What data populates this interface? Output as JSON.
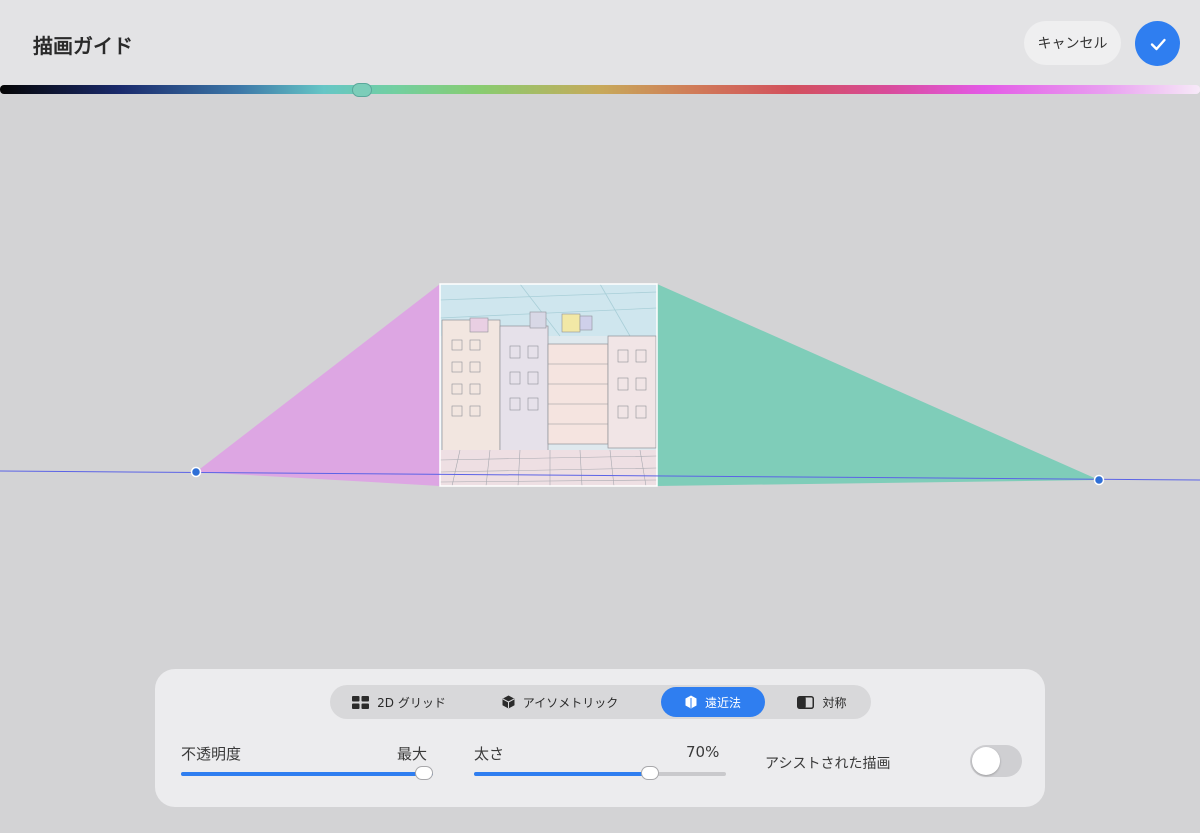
{
  "header": {
    "title": "描画ガイド",
    "cancel_label": "キャンセル",
    "confirm_icon": "checkmark-icon"
  },
  "color_picker": {
    "hue_position": 0.302,
    "selected_color": "#7ccdb9"
  },
  "guide": {
    "left_fill": "#dda6e3",
    "right_fill": "#7fcdb9",
    "horizon_color": "#5b63e6",
    "handle_color": "#2f6fd6"
  },
  "modes": {
    "items": [
      {
        "label": "2D グリッド",
        "icon": "grid-icon"
      },
      {
        "label": "アイソメトリック",
        "icon": "cube-icon"
      },
      {
        "label": "遠近法",
        "icon": "perspective-cube-icon"
      },
      {
        "label": "対称",
        "icon": "symmetry-icon"
      }
    ],
    "active_index": 2
  },
  "opacity": {
    "label": "不透明度",
    "value_label": "最大",
    "fraction": 1.0
  },
  "thickness": {
    "label": "太さ",
    "value_label": "70%",
    "fraction": 0.7
  },
  "assisted": {
    "label": "アシストされた描画",
    "enabled": false
  },
  "colors": {
    "accent": "#2f7ef0",
    "background": "#d3d3d5",
    "header_bg": "#e3e3e5",
    "panel_bg": "#ececee"
  }
}
